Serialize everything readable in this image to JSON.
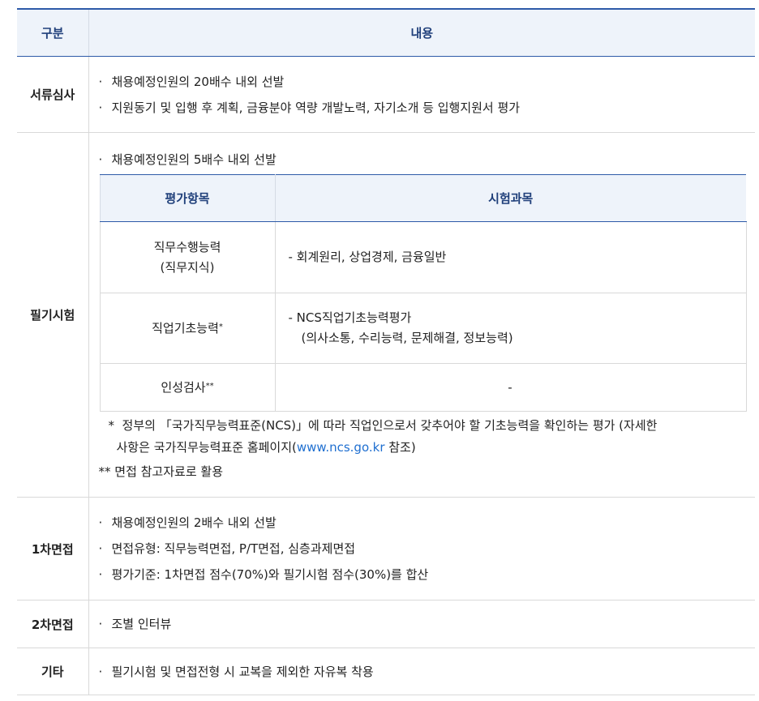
{
  "header": {
    "col1": "구분",
    "col2": "내용"
  },
  "rows": {
    "doc": {
      "label": "서류심사",
      "bullets": [
        "채용예정인원의 20배수 내외 선발",
        "지원동기 및 입행 후 계획, 금융분야 역량 개발노력, 자기소개 등 입행지원서 평가"
      ]
    },
    "written": {
      "label": "필기시험",
      "bullet": "채용예정인원의 5배수 내외 선발",
      "sub_header": {
        "col1": "평가항목",
        "col2": "시험과목"
      },
      "sub_rows": [
        {
          "item_line1": "직무수행능력",
          "item_line2": "(직무지식)",
          "subject": "-  회계원리, 상업경제, 금융일반"
        },
        {
          "item": "직업기초능력",
          "mark": "*",
          "subject_line1": "-  NCS직업기초능력평가",
          "subject_line2": "(의사소통, 수리능력, 문제해결, 정보능력)"
        },
        {
          "item": "인성검사",
          "mark": "**",
          "subject": "-"
        }
      ],
      "note1_mark": "*",
      "note1_line1": "정부의 「국가직무능력표준(NCS)」에 따라 직업인으로서 갖추어야 할 기초능력을 확인하는 평가 (자세한",
      "note1_line2_pre": "사항은 국가직무능력표준 홈페이지(",
      "note1_link": "www.ncs.go.kr",
      "note1_line2_post": " 참조)",
      "note2": "** 면접 참고자료로 활용"
    },
    "interview1": {
      "label": "1차면접",
      "bullets": [
        "채용예정인원의 2배수 내외 선발",
        "면접유형: 직무능력면접, P/T면접, 심층과제면접",
        "평가기준: 1차면접 점수(70%)와 필기시험 점수(30%)를 합산"
      ]
    },
    "interview2": {
      "label": "2차면접",
      "bullet": "조별 인터뷰"
    },
    "etc": {
      "label": "기타",
      "bullet": "필기시험 및 면접전형 시 교복을 제외한 자유복 착용"
    }
  },
  "bullet_mark": "·",
  "colors": {
    "header_bg": "#eef3fa",
    "header_border": "#2d5aa8",
    "link": "#1f6fd0"
  }
}
